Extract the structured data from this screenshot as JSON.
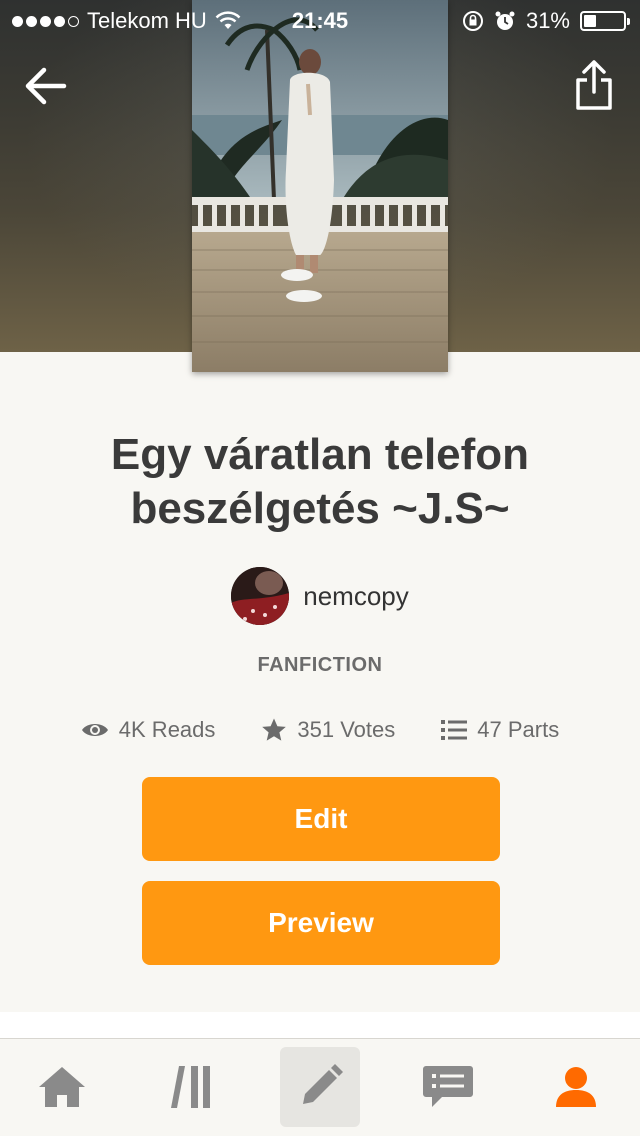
{
  "status_bar": {
    "carrier": "Telekom HU",
    "time": "21:45",
    "battery": "31%",
    "battery_level": 0.31
  },
  "header": {
    "back_icon": "arrow-left-icon",
    "share_icon": "share-icon"
  },
  "story": {
    "title": "Egy váratlan telefon beszélgetés ~J.S~",
    "author": "nemcopy",
    "category": "FANFICTION",
    "stats": {
      "reads": "4K Reads",
      "votes": "351 Votes",
      "parts": "47 Parts"
    }
  },
  "actions": {
    "edit_label": "Edit",
    "preview_label": "Preview"
  },
  "tab_bar": {
    "items": [
      {
        "name": "home",
        "icon": "home-icon"
      },
      {
        "name": "library",
        "icon": "library-icon"
      },
      {
        "name": "write",
        "icon": "pencil-icon",
        "active": true
      },
      {
        "name": "messages",
        "icon": "chat-icon"
      },
      {
        "name": "profile",
        "icon": "person-icon"
      }
    ]
  },
  "colors": {
    "accent": "#ff9811",
    "text": "#3a3a3a",
    "muted": "#6b6b6b",
    "background": "#f8f7f3",
    "icon_gray": "#888888"
  }
}
